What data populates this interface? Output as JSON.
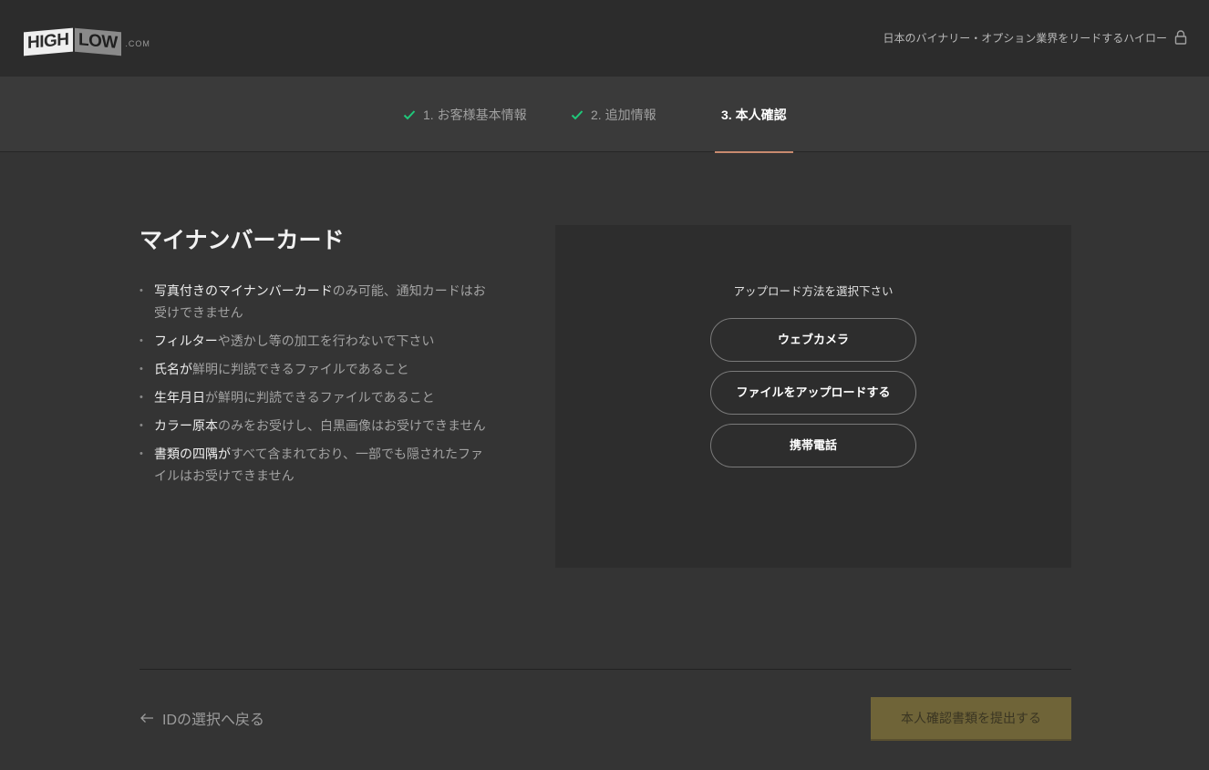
{
  "header": {
    "logo": {
      "high": "HIGH",
      "low": "LOW",
      "dotcom": ".COM"
    },
    "tagline": "日本のバイナリー・オプション業界をリードするハイロー",
    "lock_icon": "lock-icon"
  },
  "steps": [
    {
      "label": "1. お客様基本情報",
      "status": "done"
    },
    {
      "label": "2. 追加情報",
      "status": "done"
    },
    {
      "label": "3. 本人確認",
      "status": "active"
    }
  ],
  "document": {
    "title": "マイナンバーカード",
    "requirements": [
      {
        "bold": "写真付きのマイナンバーカード",
        "rest": "のみ可能、通知カードはお受けできません"
      },
      {
        "bold": "フィルター",
        "rest": "や透かし等の加工を行わないで下さい"
      },
      {
        "bold": "氏名が",
        "rest": "鮮明に判読できるファイルであること"
      },
      {
        "bold": "生年月日",
        "rest": "が鮮明に判読できるファイルであること"
      },
      {
        "bold": "カラー原本",
        "rest": "のみをお受けし、白黒画像はお受けできません"
      },
      {
        "bold": "書類の四隅が",
        "rest": "すべて含まれており、一部でも隠されたファイルはお受けできません"
      }
    ]
  },
  "upload": {
    "prompt": "アップロード方法を選択下さい",
    "webcam": "ウェブカメラ",
    "file": "ファイルをアップロードする",
    "phone": "携帯電話"
  },
  "footer": {
    "back": "IDの選択へ戻る",
    "submit": "本人確認書類を提出する"
  },
  "colors": {
    "check": "#1fc87a",
    "active_underline": "#c88a6e",
    "submit_bg": "#6f6438"
  }
}
